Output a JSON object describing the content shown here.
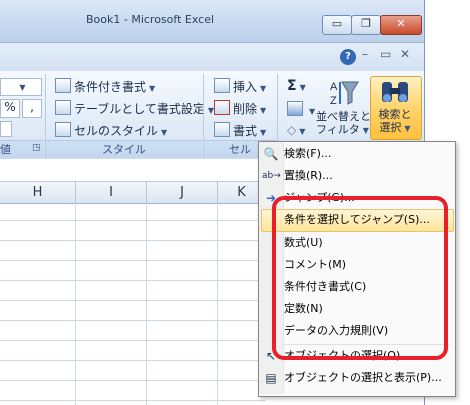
{
  "window": {
    "title": "Book1 - Microsoft Excel",
    "minimize": "▭",
    "restore": "❐",
    "close": "✕"
  },
  "subbar": {
    "help": "?",
    "min": "–",
    "restore": "▭",
    "close": "✕"
  },
  "ribbon": {
    "number_fmt_percent": "%",
    "number_fmt_comma": ",",
    "style_group": {
      "label": "スタイル",
      "items": [
        "条件付き書式",
        "テーブルとして書式設定",
        "セルのスタイル"
      ]
    },
    "cells_group": {
      "label": "セル",
      "items": [
        "挿入",
        "削除",
        "書式"
      ]
    },
    "edit_group": {
      "sum_symbol": "Σ",
      "sort_label_1": "並べ替えと",
      "sort_label_2": "フィルタ",
      "find_label_1": "検索と",
      "find_label_2": "選択"
    },
    "partial_group_label": "値"
  },
  "grid": {
    "columns": [
      "H",
      "I",
      "J",
      "K"
    ]
  },
  "menu": {
    "items": [
      {
        "label": "検索(F)...",
        "icon": "binoculars-icon"
      },
      {
        "label": "置換(R)...",
        "icon": "replace-icon"
      },
      {
        "label": "ジャンプ(G)...",
        "icon": "arrow-right-icon"
      },
      {
        "label": "条件を選択してジャンプ(S)...",
        "icon": ""
      },
      {
        "label": "数式(U)",
        "icon": ""
      },
      {
        "label": "コメント(M)",
        "icon": ""
      },
      {
        "label": "条件付き書式(C)",
        "icon": ""
      },
      {
        "label": "定数(N)",
        "icon": ""
      },
      {
        "label": "データの入力規則(V)",
        "icon": ""
      },
      {
        "label": "オブジェクトの選択(O)",
        "icon": "cursor-icon"
      },
      {
        "label": "オブジェクトの選択と表示(P)...",
        "icon": "objects-icon"
      }
    ]
  },
  "colors": {
    "highlight": "#ffe49a",
    "annotation": "#e8202a",
    "ribbon": "#dfeaf7"
  }
}
